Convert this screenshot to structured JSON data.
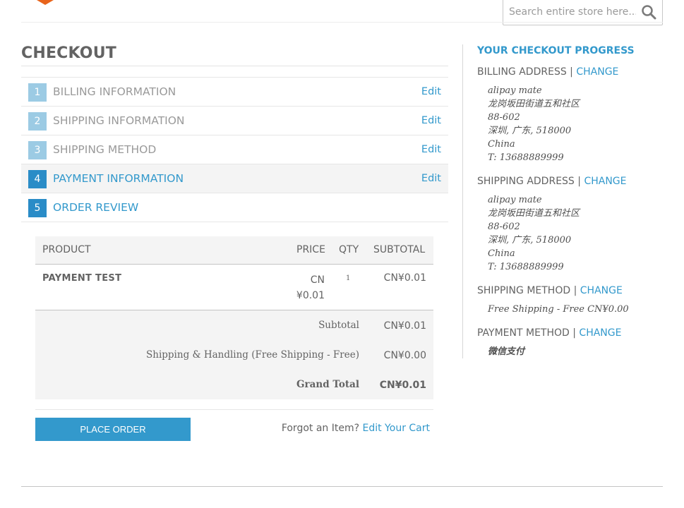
{
  "header": {
    "search_placeholder": "Search entire store here..."
  },
  "page_title": "CHECKOUT",
  "steps": [
    {
      "number": "1",
      "label": "BILLING INFORMATION",
      "edit": "Edit"
    },
    {
      "number": "2",
      "label": "SHIPPING INFORMATION",
      "edit": "Edit"
    },
    {
      "number": "3",
      "label": "SHIPPING METHOD",
      "edit": "Edit"
    },
    {
      "number": "4",
      "label": "PAYMENT INFORMATION",
      "edit": "Edit"
    },
    {
      "number": "5",
      "label": "ORDER REVIEW"
    }
  ],
  "review": {
    "columns": {
      "product": "PRODUCT",
      "price": "PRICE",
      "qty": "QTY",
      "subtotal": "SUBTOTAL"
    },
    "items": [
      {
        "name": "PAYMENT TEST",
        "price_line1": "CN",
        "price_line2": "¥0.01",
        "qty": "1",
        "subtotal": "CN¥0.01"
      }
    ],
    "totals": {
      "subtotal_label": "Subtotal",
      "subtotal_value": "CN¥0.01",
      "shipping_label": "Shipping & Handling (Free Shipping - Free)",
      "shipping_value": "CN¥0.00",
      "grand_label": "Grand Total",
      "grand_value": "CN¥0.01"
    },
    "place_order": "PLACE ORDER",
    "forgot_text": "Forgot an Item?",
    "edit_cart": "Edit Your Cart"
  },
  "progress": {
    "title": "YOUR CHECKOUT PROGRESS",
    "change": "CHANGE",
    "billing": {
      "heading": "BILLING ADDRESS",
      "name": "alipay mate",
      "street": "龙岗坂田街道五和社区",
      "line2": "88-602",
      "city": "深圳, 广东, 518000",
      "country": "China",
      "phone": "T: 13688889999"
    },
    "shipping": {
      "heading": "SHIPPING ADDRESS",
      "name": "alipay mate",
      "street": "龙岗坂田街道五和社区",
      "line2": "88-602",
      "city": "深圳, 广东, 518000",
      "country": "China",
      "phone": "T: 13688889999"
    },
    "shipping_method": {
      "heading": "SHIPPING METHOD",
      "value": "Free Shipping - Free CN¥0.00"
    },
    "payment_method": {
      "heading": "PAYMENT METHOD",
      "value": "微信支付"
    }
  }
}
